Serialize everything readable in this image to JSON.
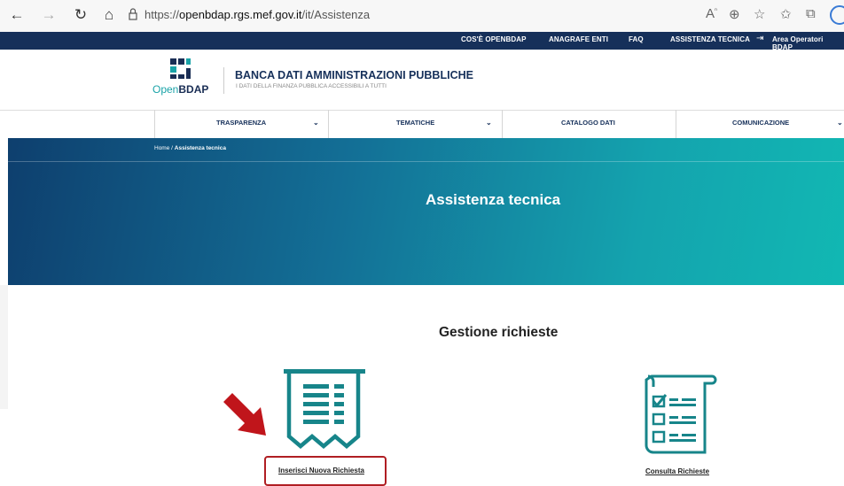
{
  "browser": {
    "url_prefix": "https://",
    "url_domain": "openbdap.rgs.mef.gov.it",
    "url_path": "/it/Assistenza",
    "icons": [
      "back-icon",
      "forward-icon",
      "refresh-icon",
      "home-icon",
      "lock-icon",
      "read-aloud-icon",
      "zoom-icon",
      "favorite-add-icon",
      "favorites-icon",
      "collections-icon",
      "profile-icon"
    ]
  },
  "topnav": {
    "items": [
      "COS'È OPENBDAP",
      "ANAGRAFE ENTI",
      "FAQ",
      "ASSISTENZA TECNICA",
      "Area Operatori BDAP"
    ]
  },
  "header": {
    "logo_text_open": "Open",
    "logo_text_bdap": "BDAP",
    "title": "BANCA DATI AMMINISTRAZIONI PUBBLICHE",
    "subtitle": "I DATI DELLA FINANZA PUBBLICA ACCESSIBILI A TUTTI"
  },
  "menu": {
    "items": [
      {
        "label": "TRASPARENZA",
        "has_dropdown": true
      },
      {
        "label": "TEMATICHE",
        "has_dropdown": true
      },
      {
        "label": "CATALOGO DATI",
        "has_dropdown": false
      },
      {
        "label": "COMUNICAZIONE",
        "has_dropdown": true
      }
    ]
  },
  "breadcrumb": {
    "home": "Home",
    "separator": " / ",
    "current": "Assistenza tecnica"
  },
  "banner": {
    "title": "Assistenza tecnica"
  },
  "main": {
    "section_title": "Gestione richieste",
    "cards": [
      {
        "label": "Inserisci Nuova Richiesta",
        "icon": "receipt-icon",
        "highlighted": true
      },
      {
        "label": "Consulta Richieste",
        "icon": "checklist-icon",
        "highlighted": false
      }
    ]
  },
  "colors": {
    "navy": "#16305a",
    "teal": "#1aa3a8",
    "highlight_red": "#b01e23"
  }
}
